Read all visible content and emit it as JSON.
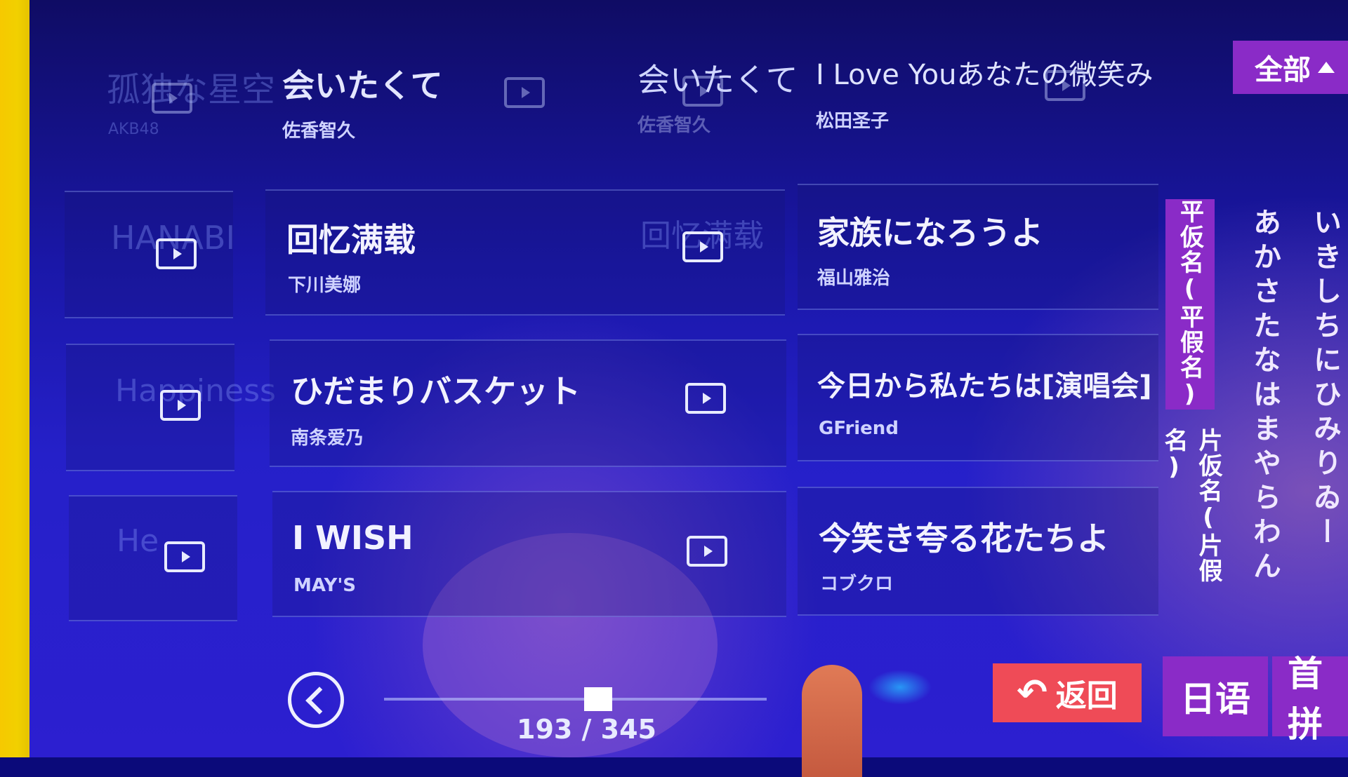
{
  "top_row": {
    "left_title": "孤独な星空",
    "left_subtitle": "AKB48",
    "song": {
      "title": "会いたくて",
      "artist": "佐香智久"
    },
    "ghost_title": "会いたくて",
    "ghost_artist": "佐香智久",
    "right_song": {
      "title": "I Love Youあなたの微笑み",
      "artist": "松田圣子"
    }
  },
  "all_button": {
    "label": "全部"
  },
  "left_ghost_titles": [
    "HANABI",
    "Happiness",
    "He"
  ],
  "left_ghost_mid": "回忆满载",
  "songs_left": [
    {
      "title": "回忆满载",
      "artist": "下川美娜"
    },
    {
      "title": "ひだまりバスケット",
      "artist": "南条爱乃"
    },
    {
      "title": "I WISH",
      "artist": "MAY'S"
    }
  ],
  "songs_right": [
    {
      "title": "家族になろうよ",
      "artist": "福山雅治"
    },
    {
      "title": "今日から私たちは[演唱会]",
      "artist": "GFriend"
    },
    {
      "title": "今笑き夸る花たちよ",
      "artist": "コブクロ"
    }
  ],
  "index": {
    "hiragana_tab": "平仮名(平假名)",
    "katakana_tab": "片仮名(片假名)",
    "column1": "あかさたなはまやらわん",
    "column2": "いきしちにひみりゐー"
  },
  "pager": {
    "current": 193,
    "total": 345,
    "label": "193 / 345"
  },
  "back_button": {
    "label": "返回"
  },
  "language_buttons": [
    {
      "label": "日语"
    },
    {
      "label": "首拼"
    }
  ],
  "colors": {
    "accent": "#8a2bc7",
    "back": "#ef4b57",
    "bg": "#1a17a8"
  }
}
